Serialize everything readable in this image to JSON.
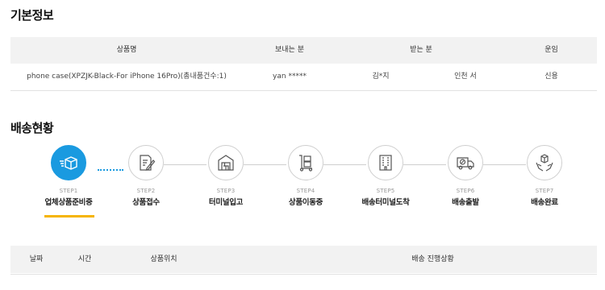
{
  "basic_info": {
    "title": "기본정보",
    "headers": {
      "product": "상품명",
      "sender": "보내는 분",
      "receiver": "받는 분",
      "fee": "운임"
    },
    "row": {
      "product": "phone case(XPZJK-Black-For iPhone 16Pro)(총내품건수:1)",
      "sender": "yan *****",
      "receiver_name": "김*지",
      "receiver_address": "인천 서",
      "fee": "신용"
    }
  },
  "delivery_status": {
    "title": "배송현황",
    "accent_color": "#1a9ae0",
    "underline_color": "#f5b400",
    "steps": [
      {
        "num": "STEP1",
        "label": "업체상품준비중",
        "icon": "box-ready-icon",
        "active": true
      },
      {
        "num": "STEP2",
        "label": "상품접수",
        "icon": "document-pen-icon",
        "active": false
      },
      {
        "num": "STEP3",
        "label": "터미널입고",
        "icon": "warehouse-icon",
        "active": false
      },
      {
        "num": "STEP4",
        "label": "상품이동중",
        "icon": "hand-truck-icon",
        "active": false
      },
      {
        "num": "STEP5",
        "label": "배송터미널도착",
        "icon": "building-icon",
        "active": false
      },
      {
        "num": "STEP6",
        "label": "배송출발",
        "icon": "delivery-truck-icon",
        "active": false
      },
      {
        "num": "STEP7",
        "label": "배송완료",
        "icon": "package-hands-icon",
        "active": false
      }
    ]
  },
  "tracking_table": {
    "headers": {
      "date": "날짜",
      "time": "시간",
      "location": "상품위치",
      "status": "배송 진행상황"
    }
  }
}
